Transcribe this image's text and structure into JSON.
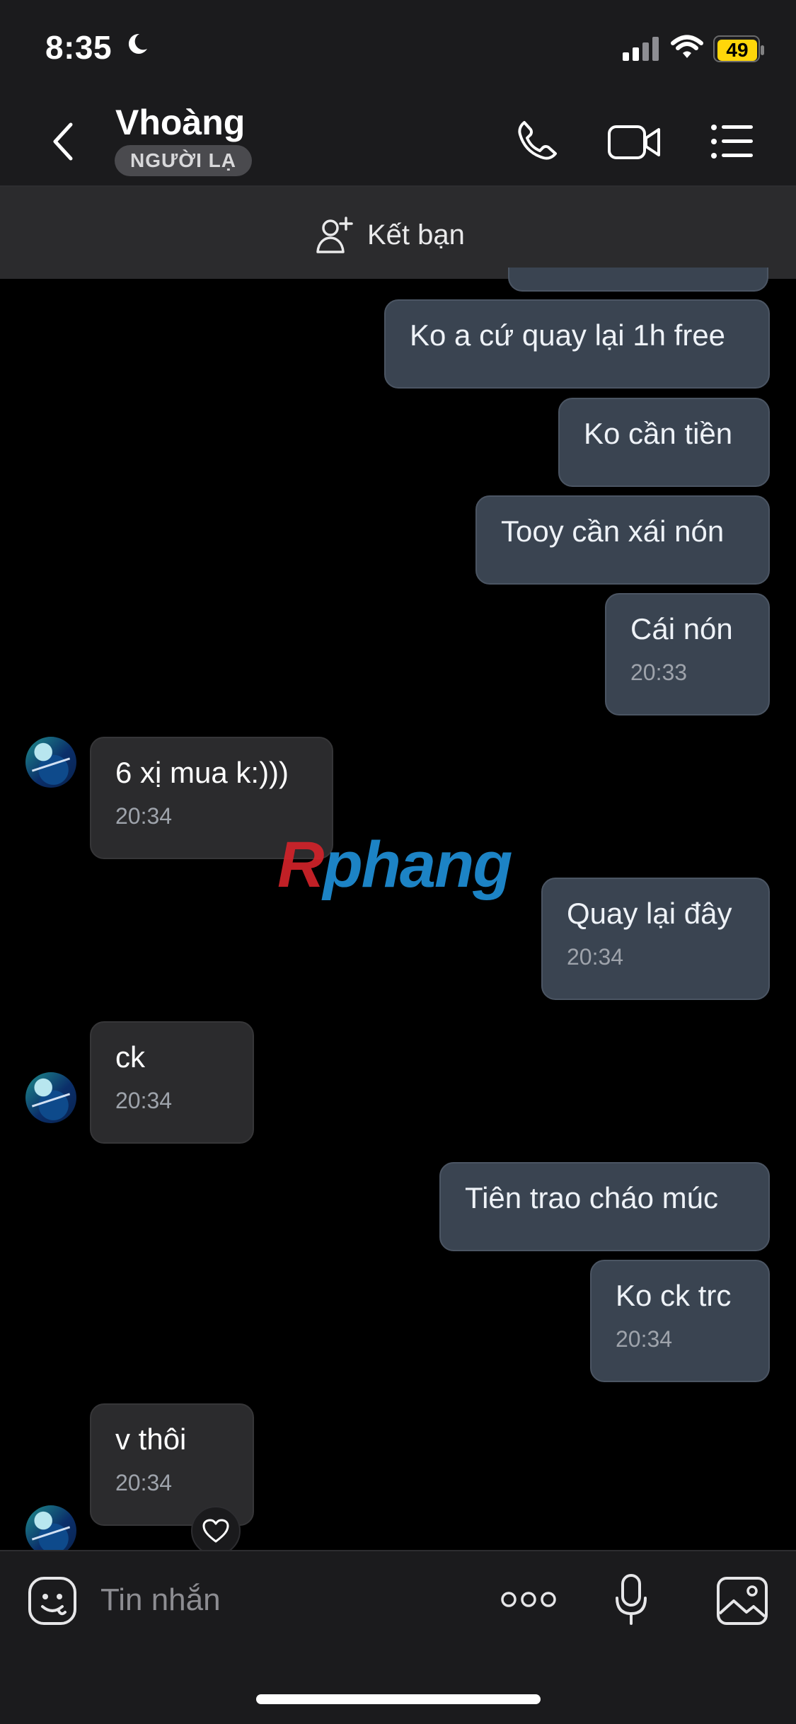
{
  "status_bar": {
    "time": "8:35",
    "battery": "49"
  },
  "header": {
    "title": "Vhoàng",
    "badge": "NGƯỜI LẠ"
  },
  "friend_bar": {
    "label": "Kết bạn"
  },
  "messages": [
    {
      "text": "Ko a cứ quay lại 1h free"
    },
    {
      "text": "Ko cần tiền"
    },
    {
      "text": "Tooy cần xái nón"
    },
    {
      "text": "Cái nón",
      "time": "20:33"
    },
    {
      "text": "6 xị mua k:)))",
      "time": "20:34"
    },
    {
      "text": "Quay lại đây",
      "time": "20:34"
    },
    {
      "text": "ck",
      "time": "20:34"
    },
    {
      "text": "Tiên trao cháo múc"
    },
    {
      "text": "Ko ck trc",
      "time": "20:34"
    },
    {
      "text": "v thôi",
      "time": "20:34"
    }
  ],
  "watermark": {
    "part1": "R",
    "part2": "phang"
  },
  "composer": {
    "placeholder": "Tin nhắn"
  },
  "colors": {
    "outgoing_bubble": "#3a4451",
    "incoming_bubble": "#2b2b2d",
    "battery": "#ffd60a"
  }
}
